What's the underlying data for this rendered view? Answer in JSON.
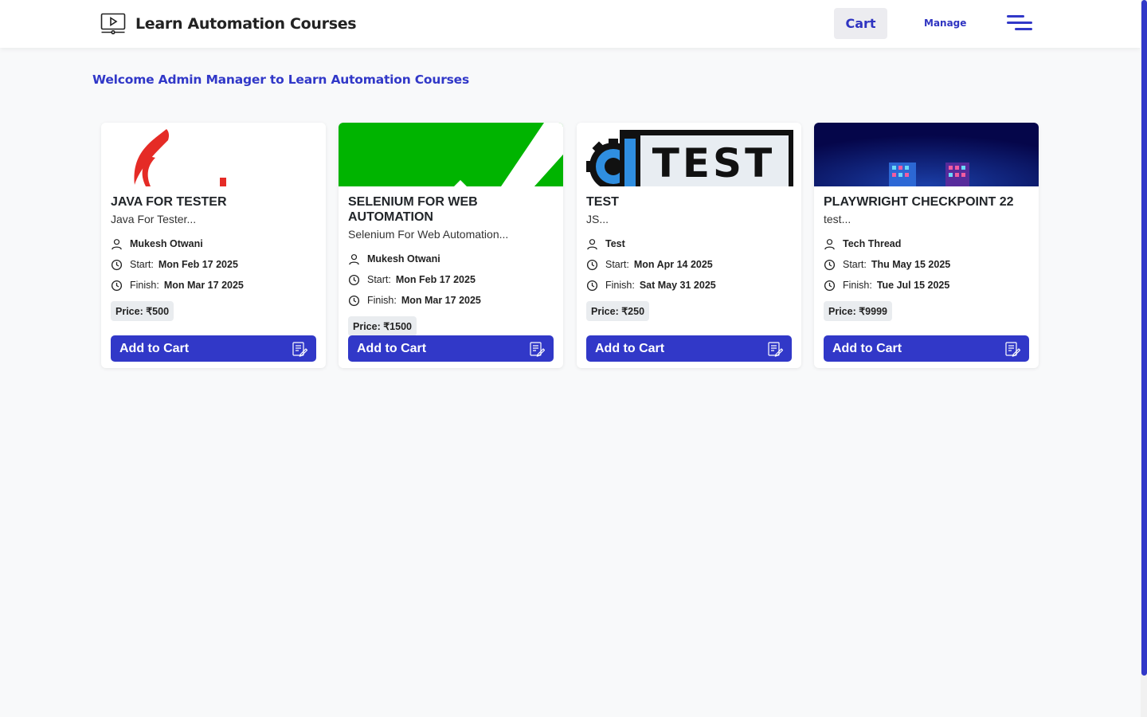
{
  "header": {
    "brand_title": "Learn Automation Courses",
    "cart_label": "Cart",
    "manage_label": "Manage",
    "accent_color": "#3138c8"
  },
  "welcome_text": "Welcome Admin Manager to Learn Automation Courses",
  "courses": [
    {
      "title": "JAVA FOR TESTER",
      "subtitle": "Java For Tester...",
      "author": "Mukesh Otwani",
      "start_label": "Start:",
      "start_date": "Mon Feb 17 2025",
      "finish_label": "Finish:",
      "finish_date": "Mon Mar 17 2025",
      "price": "Price: ₹500",
      "button_label": "Add to Cart",
      "image_icon": "java-logo"
    },
    {
      "title": "SELENIUM FOR WEB AUTOMATION",
      "subtitle": "Selenium For Web Automation...",
      "author": "Mukesh Otwani",
      "start_label": "Start:",
      "start_date": "Mon Feb 17 2025",
      "finish_label": "Finish:",
      "finish_date": "Mon Mar 17 2025",
      "price": "Price: ₹1500",
      "button_label": "Add to Cart",
      "image_icon": "selenium-logo"
    },
    {
      "title": "TEST",
      "subtitle": "JS...",
      "author": "Test",
      "start_label": "Start:",
      "start_date": "Mon Apr 14 2025",
      "finish_label": "Finish:",
      "finish_date": "Sat May 31 2025",
      "price": "Price: ₹250",
      "button_label": "Add to Cart",
      "image_icon": "test-banner",
      "image_text": "TEST"
    },
    {
      "title": "PLAYWRIGHT CHECKPOINT 22",
      "subtitle": "test...",
      "author": "Tech Thread",
      "start_label": "Start:",
      "start_date": "Thu May 15 2025",
      "finish_label": "Finish:",
      "finish_date": "Tue Jul 15 2025",
      "price": "Price: ₹9999",
      "button_label": "Add to Cart",
      "image_icon": "playwright-image"
    }
  ]
}
